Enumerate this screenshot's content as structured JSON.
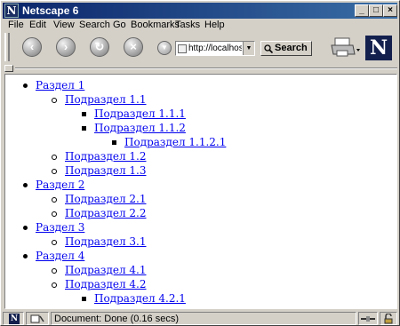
{
  "window": {
    "title": "Netscape 6",
    "app_icon": "N"
  },
  "menu": [
    "File",
    "Edit",
    "View",
    "Search",
    "Go",
    "Bookmarks",
    "Tasks",
    "Help"
  ],
  "toolbar": {
    "url": "http://localhost/",
    "search_label": "Search",
    "logo": "N"
  },
  "tree": [
    {
      "label": "Раздел 1",
      "level": 0
    },
    {
      "label": "Подраздел 1.1",
      "level": 1
    },
    {
      "label": "Подраздел 1.1.1",
      "level": 2
    },
    {
      "label": "Подраздел 1.1.2",
      "level": 2
    },
    {
      "label": "Подраздел 1.1.2.1",
      "level": 3
    },
    {
      "label": "Подраздел 1.2",
      "level": 1
    },
    {
      "label": "Подраздел 1.3",
      "level": 1
    },
    {
      "label": "Раздел 2",
      "level": 0
    },
    {
      "label": "Подраздел 2.1",
      "level": 1
    },
    {
      "label": "Подраздел 2.2",
      "level": 1
    },
    {
      "label": "Раздел 3",
      "level": 0
    },
    {
      "label": "Подраздел 3.1",
      "level": 1
    },
    {
      "label": "Раздел 4",
      "level": 0
    },
    {
      "label": "Подраздел 4.1",
      "level": 1
    },
    {
      "label": "Подраздел 4.2",
      "level": 1
    },
    {
      "label": "Подраздел 4.2.1",
      "level": 2
    }
  ],
  "status": {
    "text": "Document: Done (0.16 secs)"
  },
  "colors": {
    "titlebar_start": "#0a246a",
    "titlebar_end": "#3a6ea5",
    "link": "#0000ee",
    "chrome": "#d4d0c8"
  }
}
